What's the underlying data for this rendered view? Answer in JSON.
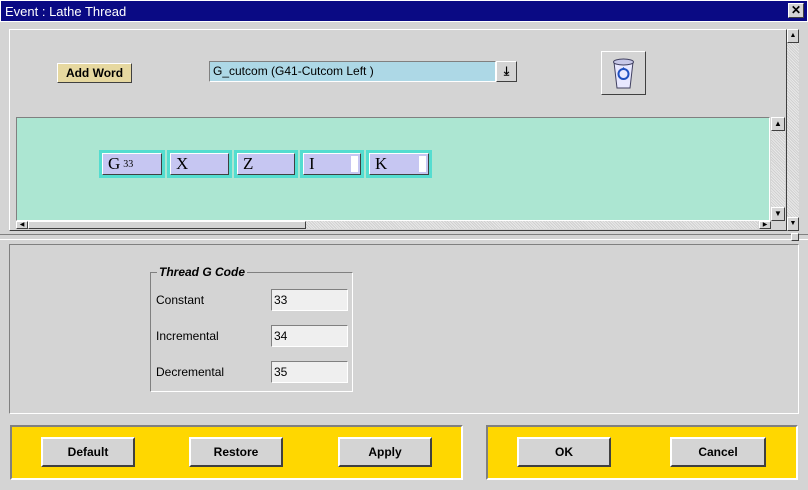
{
  "window": {
    "title": "Event : Lathe Thread",
    "close_glyph": "✕"
  },
  "toolbar": {
    "add_word_label": "Add Word",
    "combo_value": "G_cutcom (G41-Cutcom Left )",
    "combo_arrow": "⤓",
    "trash_icon": "recycle-bin-icon"
  },
  "words": [
    {
      "letter": "G",
      "sub": "33"
    },
    {
      "letter": "X",
      "sub": ""
    },
    {
      "letter": "Z",
      "sub": ""
    },
    {
      "letter": "I",
      "sub": ""
    },
    {
      "letter": "K",
      "sub": ""
    }
  ],
  "group": {
    "title": "Thread G Code",
    "fields": [
      {
        "label": "Constant",
        "value": "33"
      },
      {
        "label": "Incremental",
        "value": "34"
      },
      {
        "label": "Decremental",
        "value": "35"
      }
    ]
  },
  "buttons": {
    "default": "Default",
    "restore": "Restore",
    "apply": "Apply",
    "ok": "OK",
    "cancel": "Cancel"
  },
  "colors": {
    "titlebar": "#0a0a84",
    "panel_yellow": "#ffd700",
    "word_area": "#ace6d2",
    "combo": "#add8e6"
  }
}
